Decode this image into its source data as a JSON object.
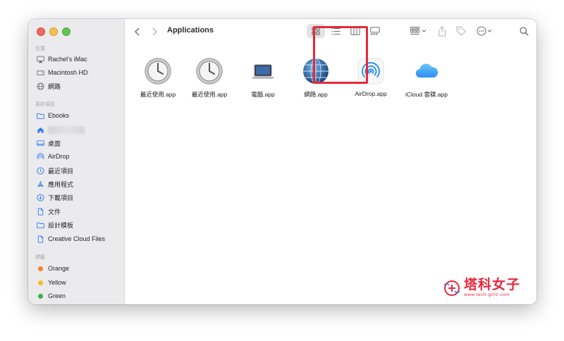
{
  "window": {
    "title": "Applications"
  },
  "sidebar": {
    "section_locations": "位置",
    "locations": [
      {
        "label": "Rachel's iMac",
        "icon": "imac-icon"
      },
      {
        "label": "Macintosh HD",
        "icon": "hard-drive-icon"
      },
      {
        "label": "網路",
        "icon": "network-globe-icon"
      }
    ],
    "section_favorites": "喜好項目",
    "favorites": [
      {
        "label": "Ebooks",
        "icon": "folder-icon"
      },
      {
        "label": "",
        "icon": "home-icon"
      },
      {
        "label": "桌面",
        "icon": "desktop-icon"
      },
      {
        "label": "AirDrop",
        "icon": "airdrop-icon"
      },
      {
        "label": "最近項目",
        "icon": "clock-icon"
      },
      {
        "label": "應用程式",
        "icon": "applications-icon"
      },
      {
        "label": "下載項目",
        "icon": "download-icon"
      },
      {
        "label": "文件",
        "icon": "document-icon"
      },
      {
        "label": "設計模板",
        "icon": "folder-icon"
      },
      {
        "label": "Creative Cloud Files",
        "icon": "document-icon"
      }
    ],
    "section_tags": "標籤",
    "tags": [
      {
        "label": "Orange",
        "color": "#f5822a"
      },
      {
        "label": "Yellow",
        "color": "#f5bf2a"
      },
      {
        "label": "Green",
        "color": "#31b44b"
      }
    ]
  },
  "files": [
    {
      "label": "最近使用.app",
      "icon": "clock-app-icon"
    },
    {
      "label": "最近使用.app",
      "icon": "clock-app-icon"
    },
    {
      "label": "電腦.app",
      "icon": "laptop-app-icon"
    },
    {
      "label": "網路.app",
      "icon": "network-globe-app-icon"
    },
    {
      "label": "AirDrop.app",
      "icon": "airdrop-app-icon",
      "highlighted": true
    },
    {
      "label": "iCloud 雲碟.app",
      "icon": "icloud-app-icon"
    }
  ],
  "watermark": {
    "text": "塔科女子",
    "url": "www.tech-girlz.com"
  },
  "colors": {
    "highlight": "#e8283a",
    "accent": "#2d7cf6",
    "sidebar_bg": "#ebeaec"
  }
}
